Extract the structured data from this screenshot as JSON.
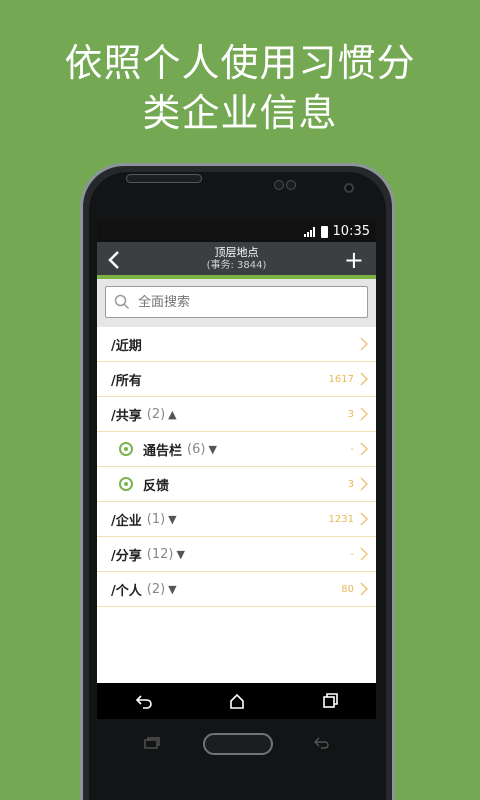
{
  "headline": {
    "line1": "依照个人使用习惯分",
    "line2": "类企业信息"
  },
  "status_bar": {
    "time": "10:35"
  },
  "app_bar": {
    "title": "顶层地点",
    "subtitle": "(事务: 3844)"
  },
  "search": {
    "placeholder": "全面搜索"
  },
  "list": [
    {
      "label": "/近期",
      "paren": "",
      "arrow": "",
      "count": "",
      "child": false
    },
    {
      "label": "/所有",
      "paren": "",
      "arrow": "",
      "count": "1617",
      "child": false
    },
    {
      "label": "/共享",
      "paren": "(2)",
      "arrow": "▲",
      "count": "3",
      "child": false
    },
    {
      "label": "通告栏",
      "paren": "(6)",
      "arrow": "▼",
      "count": "-",
      "child": true
    },
    {
      "label": "反馈",
      "paren": "",
      "arrow": "",
      "count": "3",
      "child": true
    },
    {
      "label": "/企业",
      "paren": "(1)",
      "arrow": "▼",
      "count": "1231",
      "child": false
    },
    {
      "label": "/分享",
      "paren": "(12)",
      "arrow": "▼",
      "count": "-",
      "child": false
    },
    {
      "label": "/个人",
      "paren": "(2)",
      "arrow": "▼",
      "count": "80",
      "child": false
    }
  ],
  "colors": {
    "background": "#74a852",
    "accent": "#7cb342",
    "count_color": "#e8b858"
  }
}
